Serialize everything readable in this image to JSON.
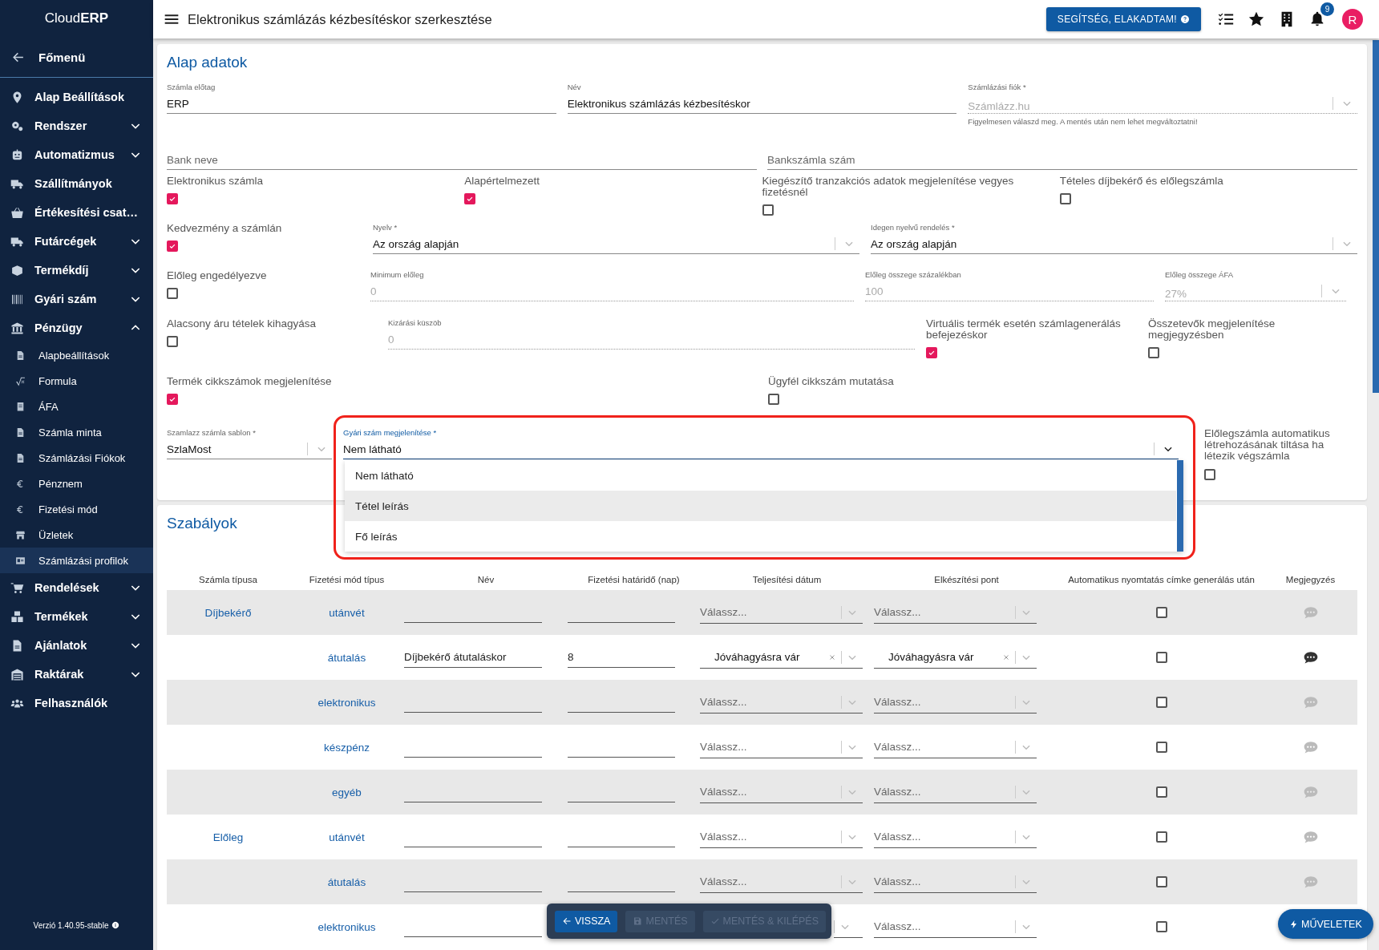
{
  "sidebar": {
    "logo": "Cloud**ERP**",
    "back_link": "Főmenü",
    "items": [
      {
        "label": "Alap Beállítások",
        "selected": false
      },
      {
        "label": "Rendszer",
        "selected": false,
        "expanded": false
      },
      {
        "label": "Automatizmus",
        "selected": false,
        "expanded": false
      },
      {
        "label": "Szállítmányok",
        "selected": false
      },
      {
        "label": "Értékesítési csat…",
        "selected": false
      },
      {
        "label": "Futárcégek",
        "selected": false,
        "expanded": false
      },
      {
        "label": "Termékdíj",
        "selected": false,
        "expanded": false
      },
      {
        "label": "Gyári szám",
        "selected": false,
        "expanded": false
      },
      {
        "label": "Pénzügy",
        "selected": false,
        "expanded": true,
        "children": [
          {
            "label": "Alapbeállítások",
            "selected": false
          },
          {
            "label": "Formula",
            "selected": false
          },
          {
            "label": "ÁFA",
            "selected": false
          },
          {
            "label": "Számla minta",
            "selected": false
          },
          {
            "label": "Számlázási Fiókok",
            "selected": false
          },
          {
            "label": "Pénznem",
            "selected": false
          },
          {
            "label": "Fizetési mód",
            "selected": false
          },
          {
            "label": "Üzletek",
            "selected": false
          },
          {
            "label": "Számlázási profilok",
            "selected": true
          }
        ]
      },
      {
        "label": "Rendelések",
        "selected": false,
        "expanded": false
      },
      {
        "label": "Termékek",
        "selected": false,
        "expanded": false
      },
      {
        "label": "Ajánlatok",
        "selected": false,
        "expanded": false
      },
      {
        "label": "Raktárak",
        "selected": false,
        "expanded": false
      },
      {
        "label": "Felhasználók",
        "selected": false
      }
    ],
    "version": "Verzió 1.40.95-stable"
  },
  "header": {
    "title": "Elektronikus számlázás kézbesítéskor szerkesztése",
    "help_button": "SEGÍTSÉG, ELAKADTAM!",
    "notification_count": "9",
    "avatar": "R"
  },
  "form": {
    "title": "Alap adatok",
    "rows": [
      [
        {
          "kind": "text",
          "label": "Számla előtag",
          "value": "ERP",
          "disabled": false
        },
        {
          "kind": "text",
          "label": "Név",
          "value": "Elektronikus számlázás kézbesítéskor",
          "disabled": false
        },
        {
          "kind": "select",
          "label": "Számlázási fiók *",
          "value": "Számlázz.hu",
          "disabled": true,
          "helper": "Figyelmesen válaszd meg. A mentés után nem lehet megváltoztatni!"
        }
      ],
      [
        {
          "kind": "text",
          "placeholder": "Bank neve",
          "disabled": false
        },
        {
          "kind": "text",
          "placeholder": "Bankszámla szám",
          "disabled": false
        }
      ],
      [
        {
          "kind": "checkbox",
          "label": "Elektronikus számla",
          "checked": true
        },
        {
          "kind": "checkbox",
          "label": "Alapértelmezett",
          "checked": true
        },
        {
          "kind": "checkbox",
          "label": "Kiegészítő tranzakciós adatok megjelenítése vegyes fizetésnél",
          "checked": false
        },
        {
          "kind": "checkbox",
          "label": "Tételes díjbekérő és előlegszámla",
          "checked": false
        }
      ],
      [
        {
          "kind": "checkbox",
          "label": "Kedvezmény a számlán",
          "checked": true
        },
        {
          "kind": "select",
          "label": "Nyelv *",
          "value": "Az ország alapján",
          "disabled": false
        },
        {
          "kind": "select",
          "label": "Idegen nyelvű rendelés *",
          "value": "Az ország alapján",
          "disabled": false
        }
      ],
      [
        {
          "kind": "checkbox",
          "label": "Előleg engedélyezve",
          "checked": false
        },
        {
          "kind": "text",
          "label": "Minimum előleg",
          "value": "0",
          "disabled": true
        },
        {
          "kind": "text",
          "label": "Előleg összege százalékban",
          "value": "100",
          "disabled": true
        },
        {
          "kind": "select",
          "label": "Előleg összege ÁFA",
          "value": "27%",
          "disabled": true
        }
      ],
      [
        {
          "kind": "checkbox",
          "label": "Alacsony áru tételek kihagyása",
          "checked": false
        },
        {
          "kind": "text",
          "label": "Kizárási küszöb",
          "value": "0",
          "disabled": true
        },
        {
          "kind": "checkbox",
          "label": "Virtuális termék esetén számlagenerálás befejezéskor",
          "checked": true
        },
        {
          "kind": "checkbox",
          "label": "Összetevők megjelenítése megjegyzésben",
          "checked": false
        }
      ],
      [
        {
          "kind": "checkbox",
          "label": "Termék cikkszámok megjelenítése",
          "checked": true
        },
        {
          "kind": "checkbox",
          "label": "Ügyfél cikkszám mutatása",
          "checked": false
        }
      ],
      [
        {
          "kind": "select",
          "label": "Szamlazz számla sablon *",
          "value": "SzlaMost",
          "disabled": false
        },
        {
          "kind": "select",
          "label": "Gyári szám megjelenítése *",
          "value": "Nem látható",
          "disabled": false,
          "open": true,
          "highlighted": true,
          "options": [
            {
              "label": "Nem látható",
              "hovered": false
            },
            {
              "label": "Tétel leírás",
              "hovered": true
            },
            {
              "label": "Fő leírás",
              "hovered": false
            }
          ]
        },
        {
          "kind": "checkbox",
          "label": "Előlegszámla automatikus létrehozásának tiltása ha létezik végszámla",
          "checked": false
        }
      ]
    ]
  },
  "rules": {
    "title": "Szabályok",
    "columns": [
      "Számla típusa",
      "Fizetési mód típus",
      "Név",
      "Fizetési határidő (nap)",
      "Teljesítési dátum",
      "Elkészítési pont",
      "Automatikus nyomtatás címke generálás után",
      "Megjegyzés"
    ],
    "groups": [
      {
        "invoice_type": "Díjbekérő",
        "rows": [
          {
            "payment_type": "utánvét",
            "fulfillment": {
              "placeholder": "Válassz..."
            },
            "completion": {
              "placeholder": "Válassz..."
            },
            "auto_print": false,
            "comment": false
          },
          {
            "payment_type": "átutalás",
            "name": "Díjbekérő átutaláskor",
            "deadline": "8",
            "fulfillment": {
              "value": "Jóváhagyásra vár"
            },
            "completion": {
              "value": "Jóváhagyásra vár"
            },
            "auto_print": false,
            "comment": true
          },
          {
            "payment_type": "elektronikus",
            "fulfillment": {
              "placeholder": "Válassz..."
            },
            "completion": {
              "placeholder": "Válassz..."
            },
            "auto_print": false,
            "comment": false
          },
          {
            "payment_type": "készpénz",
            "fulfillment": {
              "placeholder": "Válassz..."
            },
            "completion": {
              "placeholder": "Válassz..."
            },
            "auto_print": false,
            "comment": false
          },
          {
            "payment_type": "egyéb",
            "fulfillment": {
              "placeholder": "Válassz..."
            },
            "completion": {
              "placeholder": "Válassz..."
            },
            "auto_print": false,
            "comment": false
          }
        ]
      },
      {
        "invoice_type": "Előleg",
        "rows": [
          {
            "payment_type": "utánvét",
            "fulfillment": {
              "placeholder": "Válassz..."
            },
            "completion": {
              "placeholder": "Válassz..."
            },
            "auto_print": false,
            "comment": false
          },
          {
            "payment_type": "átutalás",
            "fulfillment": {
              "placeholder": "Válassz..."
            },
            "completion": {
              "placeholder": "Válassz..."
            },
            "auto_print": false,
            "comment": false
          },
          {
            "payment_type": "elektronikus",
            "completion": {
              "placeholder": "Válassz..."
            },
            "auto_print": false
          }
        ]
      }
    ]
  },
  "toolbar": [
    {
      "label": "VISSZA",
      "disabled": false
    },
    {
      "label": "MENTÉS",
      "disabled": true
    },
    {
      "label": "MENTÉS & KILÉPÉS",
      "disabled": true
    }
  ],
  "operations_button": "MŰVELETEK"
}
